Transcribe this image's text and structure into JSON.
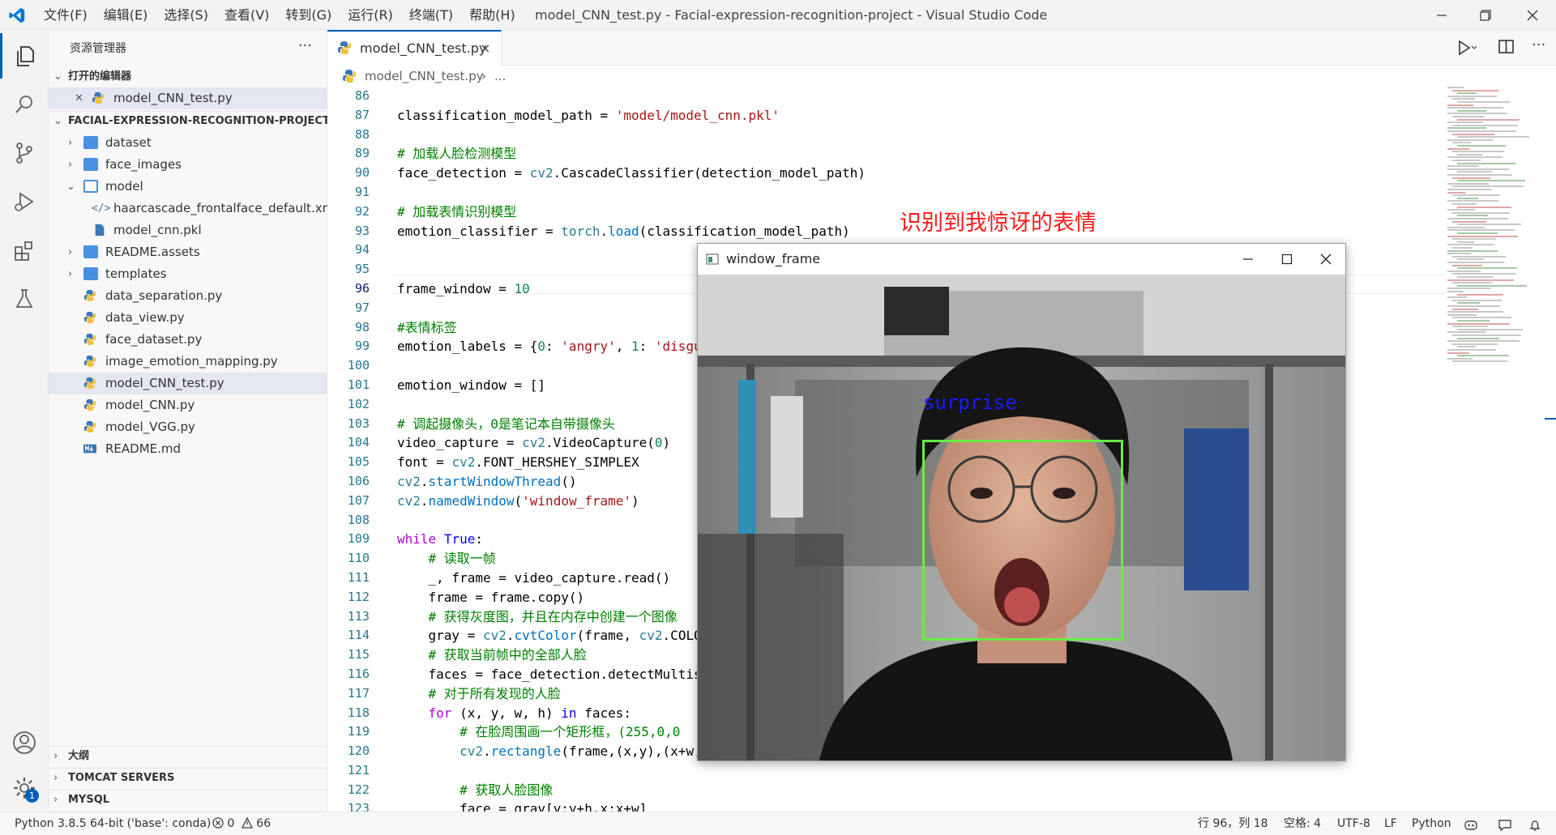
{
  "window": {
    "title": "model_CNN_test.py - Facial-expression-recognition-project - Visual Studio Code"
  },
  "menu": [
    "文件(F)",
    "编辑(E)",
    "选择(S)",
    "查看(V)",
    "转到(G)",
    "运行(R)",
    "终端(T)",
    "帮助(H)"
  ],
  "sidebar": {
    "title": "资源管理器",
    "more": "···",
    "open_editors": {
      "title": "打开的编辑器",
      "file": "model_CNN_test.py"
    },
    "project": {
      "title": "FACIAL-EXPRESSION-RECOGNITION-PROJECT",
      "items": [
        {
          "label": "dataset",
          "type": "folder"
        },
        {
          "label": "face_images",
          "type": "folder"
        },
        {
          "label": "model",
          "type": "folder-open"
        },
        {
          "label": "haarcascade_frontalface_default.xml",
          "type": "xml"
        },
        {
          "label": "model_cnn.pkl",
          "type": "file"
        },
        {
          "label": "README.assets",
          "type": "folder"
        },
        {
          "label": "templates",
          "type": "folder"
        },
        {
          "label": "data_separation.py",
          "type": "py"
        },
        {
          "label": "data_view.py",
          "type": "py"
        },
        {
          "label": "face_dataset.py",
          "type": "py"
        },
        {
          "label": "image_emotion_mapping.py",
          "type": "py"
        },
        {
          "label": "model_CNN_test.py",
          "type": "py"
        },
        {
          "label": "model_CNN.py",
          "type": "py"
        },
        {
          "label": "model_VGG.py",
          "type": "py"
        },
        {
          "label": "README.md",
          "type": "md"
        }
      ]
    },
    "bottom_sections": [
      "大纲",
      "TOMCAT SERVERS",
      "MYSQL"
    ],
    "settings_badge": "1"
  },
  "editor": {
    "tab": "model_CNN_test.py",
    "tab_close": "×",
    "breadcrumb_file": "model_CNN_test.py",
    "breadcrumb_more": "...",
    "line_numbers": [
      "86",
      "87",
      "88",
      "89",
      "90",
      "91",
      "92",
      "93",
      "94",
      "95",
      "96",
      "97",
      "98",
      "99",
      "100",
      "101",
      "102",
      "103",
      "104",
      "105",
      "106",
      "107",
      "108",
      "109",
      "110",
      "111",
      "112",
      "113",
      "114",
      "115",
      "116",
      "117",
      "118",
      "119",
      "120",
      "121",
      "122",
      "123"
    ],
    "current_line": "96",
    "code": {
      "l87_a": "classification_model_path = ",
      "l87_b": "'model/model_cnn.pkl'",
      "l89": "# 加载人脸检测模型",
      "l90_a": "face_detection = ",
      "l90_b": "cv2",
      "l90_c": ".CascadeClassifier(detection_model_path)",
      "l92": "# 加载表情识别模型",
      "l93_a": "emotion_classifier = ",
      "l93_b": "torch",
      "l93_c": ".",
      "l93_d": "load",
      "l93_e": "(classification_model_path)",
      "l96_a": "frame_window = ",
      "l96_b": "10",
      "l98": "#表情标签",
      "l99_a": "emotion_labels = {",
      "l99_b": "0",
      "l99_c": ": ",
      "l99_d": "'angry'",
      "l99_e": ", ",
      "l99_f": "1",
      "l99_g": ": ",
      "l99_h": "'disgu",
      "l101": "emotion_window = []",
      "l103": "# 调起摄像头，0是笔记本自带摄像头",
      "l104_a": "video_capture = ",
      "l104_b": "cv2",
      "l104_c": ".VideoCapture(",
      "l104_d": "0",
      "l104_e": ")",
      "l105_a": "font = ",
      "l105_b": "cv2",
      "l105_c": ".FONT_HERSHEY_SIMPLEX",
      "l106_a": "cv2",
      "l106_b": ".",
      "l106_c": "startWindowThread",
      "l106_d": "()",
      "l107_a": "cv2",
      "l107_b": ".",
      "l107_c": "namedWindow",
      "l107_d": "(",
      "l107_e": "'window_frame'",
      "l107_f": ")",
      "l109_a": "while",
      "l109_b": " ",
      "l109_c": "True",
      "l109_d": ":",
      "l110": "    # 读取一帧",
      "l111": "    _, frame = video_capture.read()",
      "l112": "    frame = frame.copy()",
      "l113": "    # 获得灰度图，并且在内存中创建一个图像",
      "l114_a": "    gray = ",
      "l114_b": "cv2",
      "l114_c": ".",
      "l114_d": "cvtColor",
      "l114_e": "(frame, ",
      "l114_f": "cv2",
      "l114_g": ".COLO",
      "l115": "    # 获取当前帧中的全部人脸",
      "l116": "    faces = face_detection.detectMultis",
      "l117": "    # 对于所有发现的人脸",
      "l118_a": "    ",
      "l118_b": "for",
      "l118_c": " (x, y, w, h) ",
      "l118_d": "in",
      "l118_e": " faces:",
      "l119": "        # 在脸周围画一个矩形框，(255,0,0",
      "l120_a": "        ",
      "l120_b": "cv2",
      "l120_c": ".",
      "l120_d": "rectangle",
      "l120_e": "(frame,(x,y),(x+w,",
      "l122": "        # 获取人脸图像",
      "l123": "        face = gray[y:y+h,x:x+w]"
    }
  },
  "annotation": "识别到我惊讶的表情",
  "camera_window": {
    "title": "window_frame",
    "emotion_label": "surprise"
  },
  "statusbar": {
    "python": "Python 3.8.5 64-bit ('base': conda)",
    "errors": "0",
    "warnings": "66",
    "position": "行 96，列 18",
    "indent": "空格: 4",
    "encoding": "UTF-8",
    "eol": "LF",
    "language": "Python"
  },
  "colors": {
    "accent": "#005fb8",
    "annotation": "#ff1a1a",
    "face_box": "#66ee44",
    "emotion_label": "#1a1aff"
  }
}
